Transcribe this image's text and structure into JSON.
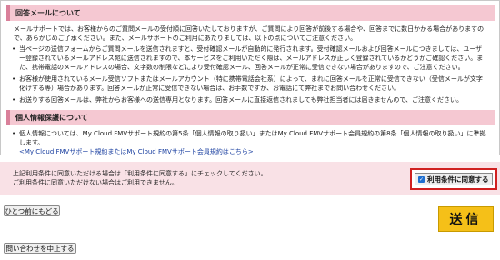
{
  "reply_section": {
    "heading": "回答メールについて",
    "intro": "メールサポートでは、お客様からのご質問メールの受付順に回答いたしておりますが、ご質問により回答が前後する場合や、回答までに数日かかる場合がありますので、あらかじめご了承ください。また、メールサポートのご利用にあたりましては、以下の点についてご注意ください。",
    "bullets": [
      "当ページの送信フォームからご質問メールを送信されますと、受付確認メールが自動的に発行されます。受付確認メールおよび回答メールにつきましては、ユーザー登録されているメールアドレス宛に送信されますので、本サービスをご利用いただく際は、メールアドレスが正しく登録されているかどうかご確認ください。また、携帯電話のメールアドレスの場合、文字数の制限などにより受付確認メール、回答メールが正常に受信できない場合がありますので、ご注意ください。",
      "お客様が使用されているメール受信ソフトまたはメールアカウント（特に携帯電話会社系）によって、まれに回答メールを正常に受信できない（受信メールが文字化けする等）場合があります。回答メールが正常に受信できない場合は、お手数ですが、お電話にて弊社までお問い合わせください。",
      "お送りする回答メールは、弊社からお客様への送信専用となります。回答メールに直接返信されましても弊社担当者には届きませんので、ご注意ください。"
    ]
  },
  "privacy_section": {
    "heading": "個人情報保護について",
    "bullet": "個人情報については、My Cloud FMVサポート規約の第5条「個人情報の取り扱い」またはMy Cloud FMVサポート会員規約の第8条「個人情報の取り扱い」に準拠します。",
    "link": "<My Cloud FMVサポート規約またはMy Cloud FMVサポート会員規約はこちら>"
  },
  "agree": {
    "line1": "上記利用条件に同意いただける場合は「利用条件に同意する」にチェックしてください。",
    "line2": "ご利用条件に同意いただけない場合はご利用できません。",
    "checkbox_label": "利用条件に同意する",
    "checked": true
  },
  "buttons": {
    "back": "ひとつ前にもどる",
    "send": "送信",
    "cancel": "問い合わせを中止する"
  },
  "colors": {
    "section_bg": "#f5c8d2",
    "agree_bg": "#f9e1e6",
    "highlight_border": "#d02020",
    "send_bg": "#f5c018",
    "link": "#1a3fa0"
  }
}
